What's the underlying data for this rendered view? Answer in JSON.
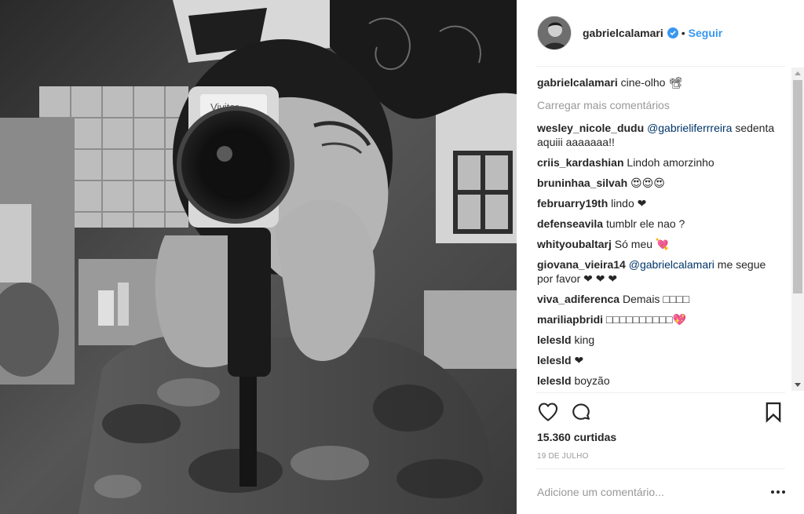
{
  "post": {
    "author": "gabrielcalamari",
    "verified": true,
    "separator_dot": "•",
    "follow_label": "Seguir",
    "caption": {
      "username": "gabrielcalamari",
      "text": "cine-olho 📽"
    },
    "load_more_label": "Carregar mais comentários",
    "comments": [
      {
        "username": "wesley_nicole_dudu",
        "mention": "@gabrieliferrreira",
        "text": "sedenta aquiii aaaaaaa!!"
      },
      {
        "username": "criis_kardashian",
        "mention": "",
        "text": "Lindoh amorzinho"
      },
      {
        "username": "bruninhaa_silvah",
        "mention": "",
        "text": "😍😍😍"
      },
      {
        "username": "februarry19th",
        "mention": "",
        "text": "lindo ❤"
      },
      {
        "username": "defenseavila",
        "mention": "",
        "text": "tumblr ele nao ?"
      },
      {
        "username": "whityoubaltarj",
        "mention": "",
        "text": "Só meu 💘"
      },
      {
        "username": "giovana_vieira14",
        "mention": "@gabrielcalamari",
        "text": "me segue por favor ❤ ❤ ❤"
      },
      {
        "username": "viva_adiferenca",
        "mention": "",
        "text": "Demais □□□□"
      },
      {
        "username": "mariliapbridi",
        "mention": "",
        "text": "□□□□□□□□□□💖"
      },
      {
        "username": "lelesld",
        "mention": "",
        "text": "king"
      },
      {
        "username": "lelesld",
        "mention": "",
        "text": "❤"
      },
      {
        "username": "lelesld",
        "mention": "",
        "text": "boyzão"
      }
    ],
    "likes_label": "15.360 curtidas",
    "date_label": "19 DE JULHO",
    "comment_placeholder": "Adicione um comentário...",
    "icons": {
      "like": "heart-icon",
      "comment": "speech-bubble-icon",
      "save": "bookmark-icon",
      "more": "ellipsis-icon",
      "verified": "verified-badge-icon"
    },
    "colors": {
      "link_blue": "#3897f0",
      "mention": "#003569",
      "muted": "#999999",
      "text": "#262626"
    }
  }
}
